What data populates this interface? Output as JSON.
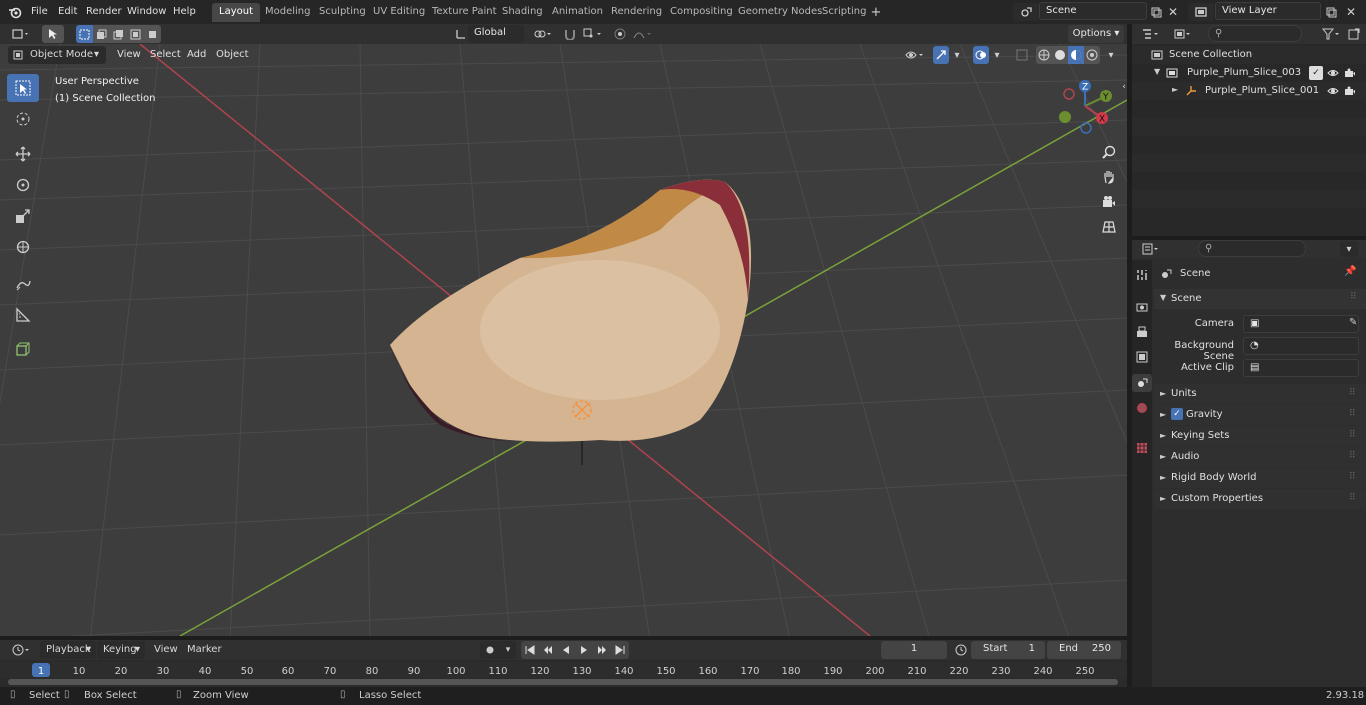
{
  "topbar": {
    "menus": [
      "File",
      "Edit",
      "Render",
      "Window",
      "Help"
    ],
    "tabs": [
      "Layout",
      "Modeling",
      "Sculpting",
      "UV Editing",
      "Texture Paint",
      "Shading",
      "Animation",
      "Rendering",
      "Compositing",
      "Geometry Nodes",
      "Scripting"
    ],
    "scene": "Scene",
    "view_layer": "View Layer"
  },
  "header": {
    "mode": "Object Mode",
    "menus": [
      "View",
      "Select",
      "Add",
      "Object"
    ],
    "orientation": "Global",
    "options": "Options"
  },
  "viewport": {
    "view_name": "User Perspective",
    "collection": "(1) Scene Collection"
  },
  "outliner": {
    "root": "Scene Collection",
    "items": [
      "Purple_Plum_Slice_003",
      "Purple_Plum_Slice_001"
    ]
  },
  "properties": {
    "title": "Scene",
    "section": "Scene",
    "camera_label": "Camera",
    "background_label": "Background Scene",
    "clip_label": "Active Clip",
    "panels": [
      "Units",
      "Gravity",
      "Keying Sets",
      "Audio",
      "Rigid Body World",
      "Custom Properties"
    ]
  },
  "timeline": {
    "menus": [
      "Playback",
      "Keying",
      "View",
      "Marker"
    ],
    "current_frame": "1",
    "start_label": "Start",
    "start": "1",
    "end_label": "End",
    "end": "250",
    "ticks": [
      "1",
      "10",
      "20",
      "30",
      "40",
      "50",
      "60",
      "70",
      "80",
      "90",
      "100",
      "110",
      "120",
      "130",
      "140",
      "150",
      "160",
      "170",
      "180",
      "190",
      "200",
      "210",
      "220",
      "230",
      "240",
      "250"
    ]
  },
  "status": {
    "select": "Select",
    "box_select": "Box Select",
    "zoom": "Zoom View",
    "lasso": "Lasso Select",
    "version": "2.93.18"
  }
}
